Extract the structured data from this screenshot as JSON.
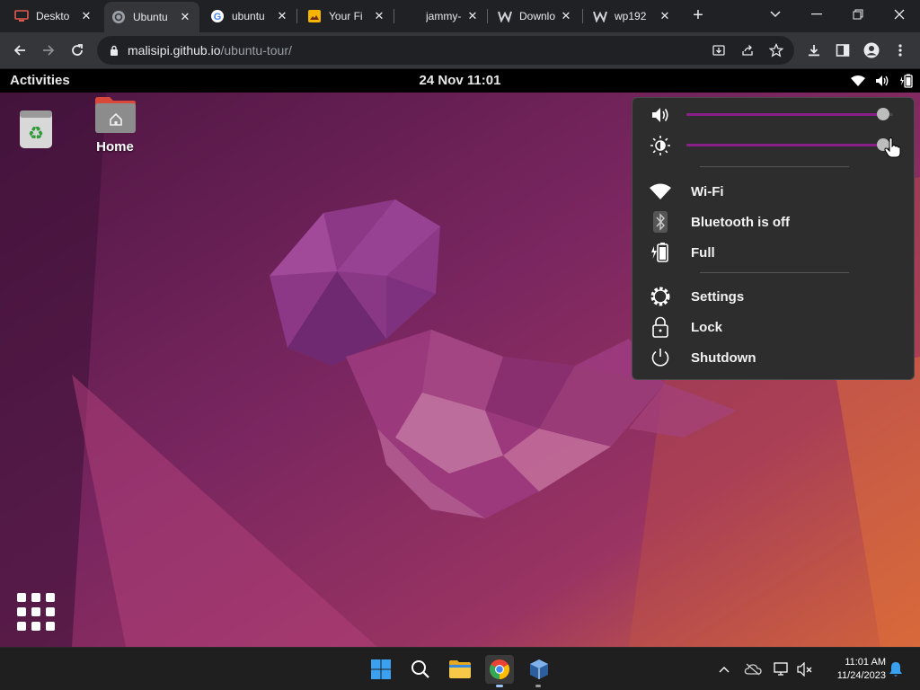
{
  "browser": {
    "tabs": [
      {
        "title": "Deskto",
        "icon": "desktop-icon"
      },
      {
        "title": "Ubuntu",
        "icon": "ubuntu-icon",
        "active": true
      },
      {
        "title": "ubuntu",
        "icon": "google-icon"
      },
      {
        "title": "Your Fi",
        "icon": "image-icon"
      },
      {
        "title": "jammy-",
        "icon": ""
      },
      {
        "title": "Downlo",
        "icon": "w-icon"
      },
      {
        "title": "wp192",
        "icon": "w-icon"
      }
    ],
    "new_tab": "+",
    "url_host": "malisipi.github.io",
    "url_path": "/ubuntu-tour/"
  },
  "ubuntu": {
    "activities": "Activities",
    "clock": "24 Nov 11:01",
    "desktop_icons": {
      "home_label": "Home"
    },
    "quick_settings": {
      "volume_level": 0.98,
      "brightness_level": 0.98,
      "wifi": "Wi-Fi",
      "bluetooth": "Bluetooth is off",
      "battery": "Full",
      "settings": "Settings",
      "lock": "Lock",
      "shutdown": "Shutdown"
    }
  },
  "taskbar": {
    "time": "11:01 AM",
    "date": "11/24/2023",
    "colors": {
      "start": "#3aa0f0",
      "chrome_red": "#ea4335",
      "chrome_yellow": "#fbbc04",
      "chrome_green": "#34a853",
      "chrome_blue": "#4285f4"
    }
  }
}
